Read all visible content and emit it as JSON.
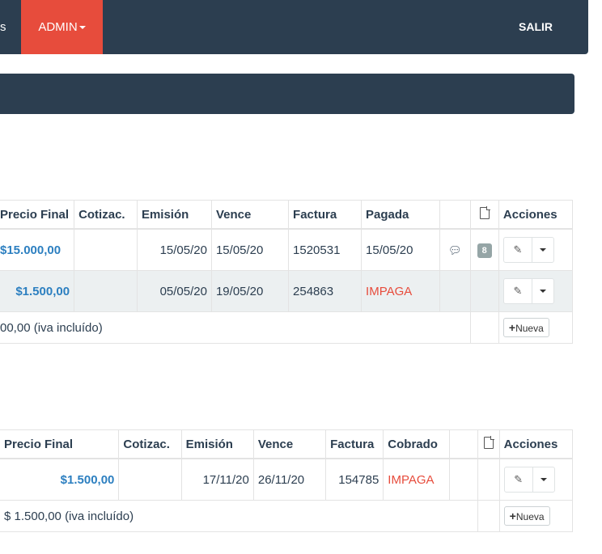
{
  "navbar": {
    "prev_item_partial": "s",
    "admin_label": "ADMIN",
    "salir_label": "SALIR"
  },
  "compras": {
    "headers": {
      "precio_final": "Precio Final",
      "cotizac": "Cotizac.",
      "emision": "Emisión",
      "vence": "Vence",
      "factura": "Factura",
      "status": "Pagada",
      "acciones": "Acciones"
    },
    "rows": [
      {
        "precio_final": "$15.000,00",
        "cotizac": "",
        "emision": "15/05/20",
        "vence": "15/05/20",
        "factura": "1520531",
        "status": "15/05/20",
        "attachments": "8"
      },
      {
        "precio_final": "$1.500,00",
        "cotizac": "",
        "emision": "05/05/20",
        "vence": "19/05/20",
        "factura": "254863",
        "status": "IMPAGA"
      }
    ],
    "total_text": "00,00 (iva incluído)",
    "new_label": "Nueva"
  },
  "ventas": {
    "headers": {
      "precio_final": "Precio Final",
      "cotizac": "Cotizac.",
      "emision": "Emisión",
      "vence": "Vence",
      "factura": "Factura",
      "status": "Cobrado",
      "acciones": "Acciones"
    },
    "rows": [
      {
        "precio_final": "$1.500,00",
        "cotizac": "",
        "emision": "17/11/20",
        "vence": "26/11/20",
        "factura": "154785",
        "status": "IMPAGA"
      }
    ],
    "total_text": "$ 1.500,00 (iva incluído)",
    "new_label": "Nueva"
  }
}
